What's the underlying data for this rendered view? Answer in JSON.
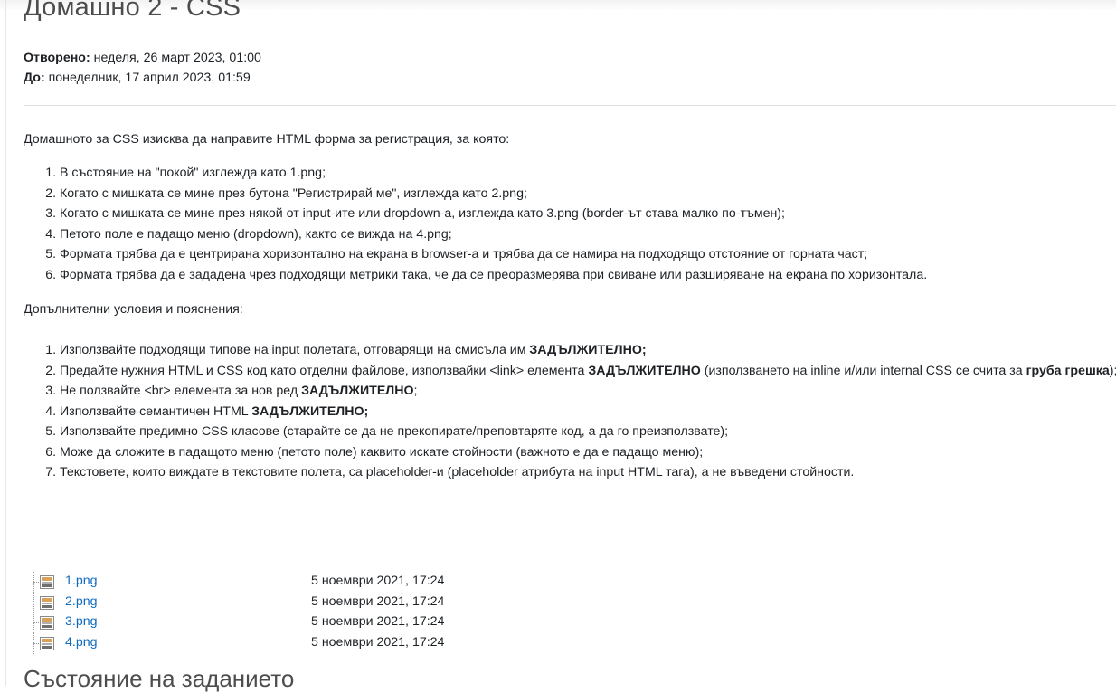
{
  "page": {
    "title": "Домашно 2 - CSS",
    "opened_label": "Отворено:",
    "opened_value": " неделя, 26 март 2023, 01:00",
    "due_label": "До:",
    "due_value": " понеделник, 17 април 2023, 01:59"
  },
  "description": {
    "intro": "Домашното за CSS изисква да направите HTML форма за регистрация, за която:",
    "requirements": [
      "В състояние на \"покой\" изглежда като 1.png;",
      "Когато с мишката се мине през бутона \"Регистрирай ме\", изглежда като 2.png;",
      "Когато с мишката се мине през някой от input-ите или dropdown-a, изглежда като 3.png (border-ът става малко по-тъмен);",
      "Петото поле е падащо меню (dropdown), както се вижда на 4.png;",
      "Формата трябва да е центрирана хоризонтално на екрана в browser-а и трябва да се намира на подходящо отстояние от горната част;",
      "Формата трябва да е зададена чрез подходящи метрики така, че да се преоразмерява при свиване или разширяване на екрана по хоризонтала."
    ],
    "extra_heading": "Допълнителни условия и пояснения:",
    "rules": {
      "r1_text": "Използвайте подходящи типове на input полетата, отговарящи на смисъла им ",
      "r1_bold": "ЗАДЪЛЖИТЕЛНО;",
      "r2_text": "Предайте нужния HTML и CSS код като отделни файлове, използвайки <link> елемента ",
      "r2_bold": "ЗАДЪЛЖИТЕЛНО",
      "r2_text2": " (използването на inline и/или internal CSS се счита за ",
      "r2_bold2": "груба грешка",
      "r2_text3": ");",
      "r3_text": "Не ползвайте <br> елемента за нов ред ",
      "r3_bold": "ЗАДЪЛЖИТЕЛНО",
      "r3_text2": ";",
      "r4_text": "Използвайте семантичен HTML ",
      "r4_bold": "ЗАДЪЛЖИТЕЛНО;",
      "r5": "Използвайте предимно CSS класове (старайте се да не прекопирате/преповтаряте код, а да го преизползвате);",
      "r6": "Може да сложите в падащото меню (петото поле) каквито искате стойности (важното е да е падащо меню);",
      "r7": "Текстовете, които виждате в текстовите полета, са placeholder-и (placeholder атрибута на input HTML тага), а не въведени стойности."
    }
  },
  "files": [
    {
      "name": "1.png",
      "date": "5 ноември 2021, 17:24"
    },
    {
      "name": "2.png",
      "date": "5 ноември 2021, 17:24"
    },
    {
      "name": "3.png",
      "date": "5 ноември 2021, 17:24"
    },
    {
      "name": "4.png",
      "date": "5 ноември 2021, 17:24"
    }
  ],
  "status_heading": "Състояние на заданието",
  "colors": {
    "link": "#0f6cbf",
    "text": "#1d2125",
    "heading": "#4d4d4d"
  }
}
